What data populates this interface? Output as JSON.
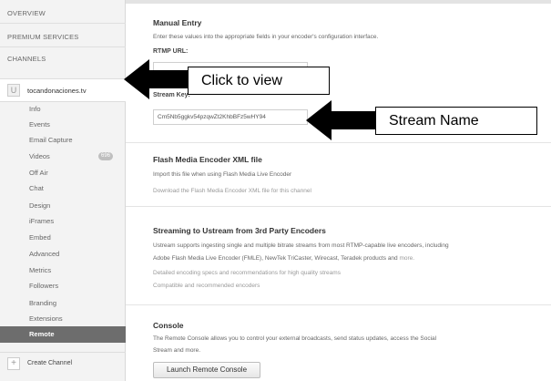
{
  "sidebar": {
    "overview": "OVERVIEW",
    "premium": "PREMIUM SERVICES",
    "channels": "CHANNELS",
    "channel_avatar": "U",
    "channel_name": "tocandonaciones.tv",
    "items": [
      {
        "label": "Info"
      },
      {
        "label": "Events"
      },
      {
        "label": "Email Capture"
      },
      {
        "label": "Videos",
        "badge": "696"
      },
      {
        "label": "Off Air"
      },
      {
        "label": "Chat"
      },
      {
        "label": "Design"
      },
      {
        "label": "iFrames"
      },
      {
        "label": "Embed"
      },
      {
        "label": "Advanced"
      },
      {
        "label": "Metrics"
      },
      {
        "label": "Followers"
      },
      {
        "label": "Branding"
      },
      {
        "label": "Extensions"
      },
      {
        "label": "Remote"
      }
    ],
    "create_channel": "Create Channel"
  },
  "manual": {
    "title": "Manual Entry",
    "description": "Enter these values into the appropriate fields in your encoder's configuration interface.",
    "rtmp_label": "RTMP URL:",
    "stream_key_label": "Stream Key:",
    "stream_key_value": "Cm5Nb5ggkv54pzqwZt2KhbBFz5wHY94"
  },
  "flash": {
    "title": "Flash Media Encoder XML file",
    "line1": "Import this file when using Flash Media Live Encoder",
    "line2": "Download the Flash Media Encoder XML file for this channel"
  },
  "third_party": {
    "title": "Streaming to Ustream from 3rd Party Encoders",
    "line1": "Ustream supports ingesting single and multiple bitrate streams from most RTMP-capable live encoders, including",
    "line2": "Adobe Flash Media Live Encoder (FMLE), NewTek TriCaster, Wirecast, Teradek products and",
    "line2_more": "more.",
    "line3": "Detailed encoding specs and recommendations for high quality streams",
    "line4": "Compatible and recommended encoders"
  },
  "console": {
    "title": "Console",
    "line1": "The Remote Console allows you to control your external broadcasts, send status updates, access the Social",
    "line2": "Stream and more.",
    "button": "Launch Remote Console"
  },
  "annotations": {
    "click_to_view": "Click to view",
    "stream_name": "Stream Name"
  },
  "colors": {
    "active_item_bg": "#6d6d6d",
    "sidebar_bg": "#f3f3f3"
  }
}
